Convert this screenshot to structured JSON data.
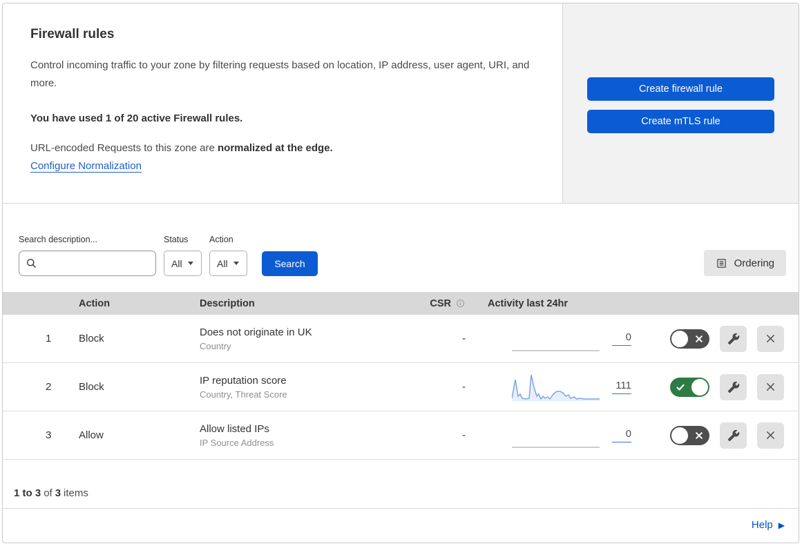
{
  "header": {
    "title": "Firewall rules",
    "description": "Control incoming traffic to your zone by filtering requests based on location, IP address, user agent, URI, and more.",
    "usage": "You have used 1 of 20 active Firewall rules.",
    "norm_prefix": "URL-encoded Requests to this zone are ",
    "norm_bold": "normalized at the edge.",
    "norm_link": "Configure Normalization",
    "buttons": [
      {
        "label": "Create firewall rule"
      },
      {
        "label": "Create mTLS rule"
      }
    ]
  },
  "filters": {
    "search_label": "Search description...",
    "status_label": "Status",
    "status_value": "All",
    "action_label": "Action",
    "action_value": "All",
    "search_button": "Search",
    "ordering_button": "Ordering"
  },
  "table": {
    "columns": {
      "action": "Action",
      "description": "Description",
      "csr": "CSR",
      "activity": "Activity last 24hr"
    },
    "rows": [
      {
        "index": "1",
        "action": "Block",
        "description": "Does not originate in UK",
        "criteria": "Country",
        "csr": "-",
        "count": "0",
        "enabled": false,
        "spark_active": false,
        "spark": [
          [
            0,
            37
          ],
          [
            127,
            37
          ]
        ]
      },
      {
        "index": "2",
        "action": "Block",
        "description": "IP reputation score",
        "criteria": "Country, Threat Score",
        "csr": "-",
        "count": "111",
        "enabled": true,
        "spark_active": true,
        "spark": [
          [
            0,
            36
          ],
          [
            5,
            9
          ],
          [
            9,
            33
          ],
          [
            12,
            30
          ],
          [
            15,
            36
          ],
          [
            20,
            37
          ],
          [
            25,
            36
          ],
          [
            28,
            2
          ],
          [
            32,
            20
          ],
          [
            36,
            33
          ],
          [
            39,
            30
          ],
          [
            42,
            37
          ],
          [
            45,
            33
          ],
          [
            48,
            36
          ],
          [
            52,
            34
          ],
          [
            55,
            37
          ],
          [
            60,
            30
          ],
          [
            65,
            26
          ],
          [
            70,
            26
          ],
          [
            75,
            29
          ],
          [
            78,
            33
          ],
          [
            82,
            31
          ],
          [
            85,
            36
          ],
          [
            90,
            34
          ],
          [
            94,
            37
          ],
          [
            99,
            36
          ],
          [
            104,
            37
          ],
          [
            109,
            37
          ],
          [
            114,
            37
          ],
          [
            120,
            37
          ],
          [
            127,
            37
          ]
        ]
      },
      {
        "index": "3",
        "action": "Allow",
        "description": "Allow listed IPs",
        "criteria": "IP Source Address",
        "csr": "-",
        "count": "0",
        "enabled": false,
        "spark_active": false,
        "spark": [
          [
            0,
            37
          ],
          [
            127,
            37
          ]
        ]
      }
    ]
  },
  "footer": {
    "range": "1 to 3",
    "of": "of",
    "total": "3",
    "items": "items"
  },
  "help": {
    "label": "Help"
  },
  "colors": {
    "accent_blue": "#0b5bd3",
    "link_blue": "#2160c4",
    "toggle_on_green": "#2c7c44",
    "toggle_off_gray": "#4e4e4e",
    "spark_blue": "#7aa5e8",
    "spark_fill": "rgba(122,165,232,0.18)",
    "spark_gray": "#bdbdbd",
    "table_header_gray": "#d8d8d8",
    "side_panel_gray": "#f2f2f2"
  }
}
